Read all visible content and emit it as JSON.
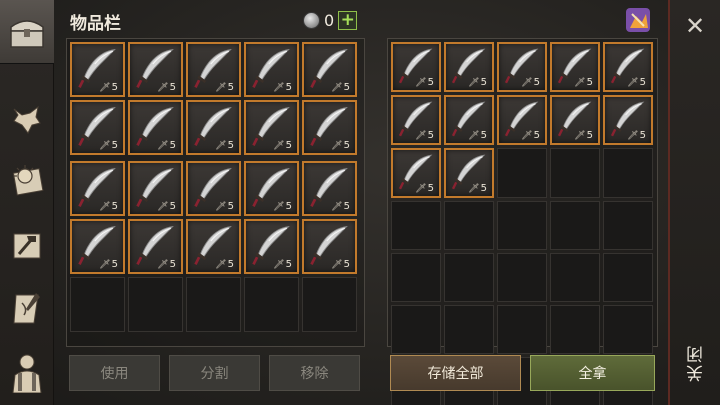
{
  "inventory": {
    "title": "物品栏",
    "currency_amount": "0",
    "add_symbol": "+",
    "slots_filled": 20,
    "slots_total": 25,
    "item_quantity": "5",
    "buttons": {
      "use": "使用",
      "split": "分割",
      "remove": "移除"
    }
  },
  "storage": {
    "slots_filled": 12,
    "slots_total": 35,
    "buttons": {
      "store_all": "存储全部",
      "take_all": "全拿"
    }
  },
  "close": {
    "icon": "close-icon",
    "label": "关闭"
  },
  "sidebar": {
    "tabs": [
      {
        "icon": "chest-icon",
        "active": true
      },
      {
        "icon": "wolf-icon",
        "active": false
      },
      {
        "icon": "sun-book-icon",
        "active": false
      },
      {
        "icon": "hammer-map-icon",
        "active": false
      },
      {
        "icon": "quest-scroll-icon",
        "active": false
      },
      {
        "icon": "character-icon",
        "active": false
      }
    ]
  },
  "colors": {
    "slot_border": "#c27a2c",
    "close_accent": "#5d2a22",
    "take_button": "#5f6b3a",
    "store_button": "#5b4a39"
  }
}
